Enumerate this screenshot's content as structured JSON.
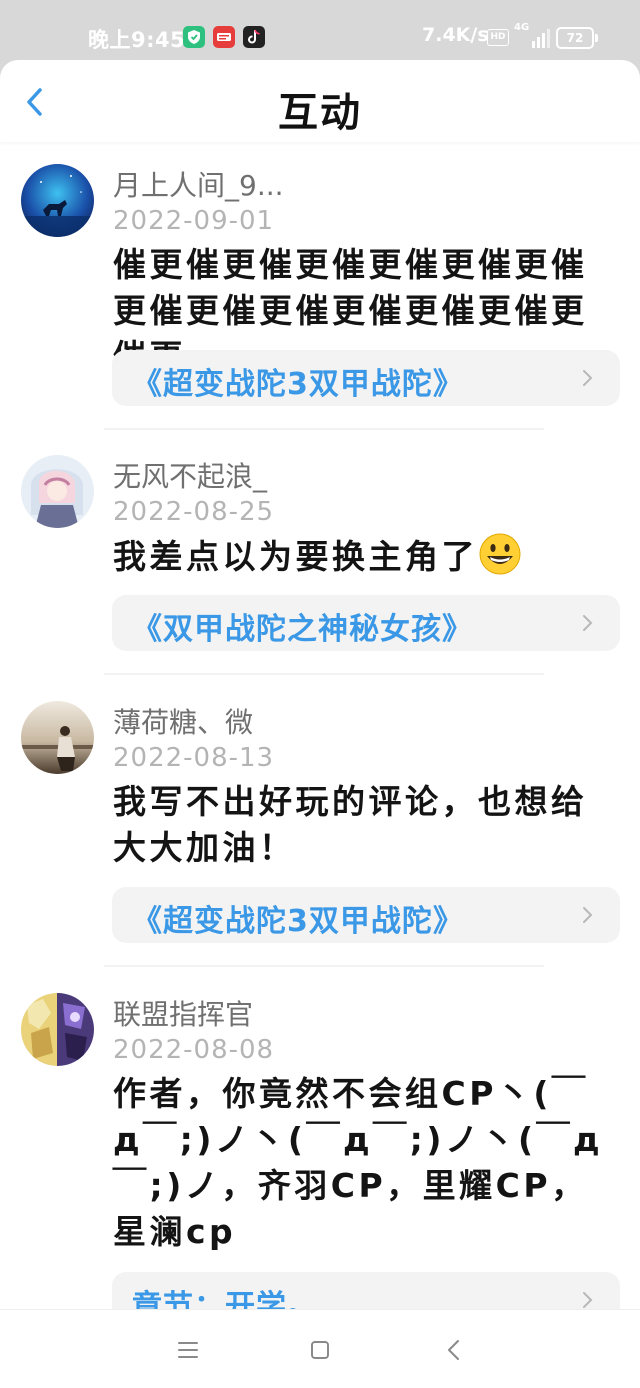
{
  "status_bar": {
    "time": "晚上9:45",
    "app_icons": [
      "shield-app-icon",
      "news-app-icon",
      "tiktok-app-icon"
    ],
    "net_speed": "7.4K/s",
    "hd_badge": "HD",
    "network": "4G",
    "battery": "72"
  },
  "header": {
    "title": "互动",
    "back_icon": "chevron-left-icon"
  },
  "comments": [
    {
      "username": "月上人间_9...",
      "date": "2022-09-01",
      "content": "催更催更催更催更催更催更催更催更催更催更催更催更催更催更",
      "link": "《超变战陀3双甲战陀》"
    },
    {
      "username": "无风不起浪_",
      "date": "2022-08-25",
      "content": "我差点以为要换主角了",
      "emoji": "grinning-face-emoji",
      "link": "《双甲战陀之神秘女孩》"
    },
    {
      "username": "薄荷糖、微",
      "date": "2022-08-13",
      "content": "我写不出好玩的评论，也想给大大加油！",
      "link": "《超变战陀3双甲战陀》"
    },
    {
      "username": "联盟指挥官",
      "date": "2022-08-08",
      "content": "作者，你竟然不会组CP丶(￣д￣;)ノ丶(￣д￣;)ノ丶(￣д￣;)ノ，齐羽CP，里耀CP，星澜cp",
      "link": "章节：开学。"
    }
  ],
  "nav_bar": {
    "buttons": [
      "menu-icon",
      "home-square-icon",
      "back-triangle-icon"
    ]
  },
  "colors": {
    "accent": "#3a98e6",
    "status_bar_bg": "#d8d8d8",
    "link_box_bg": "#f3f3f3"
  }
}
